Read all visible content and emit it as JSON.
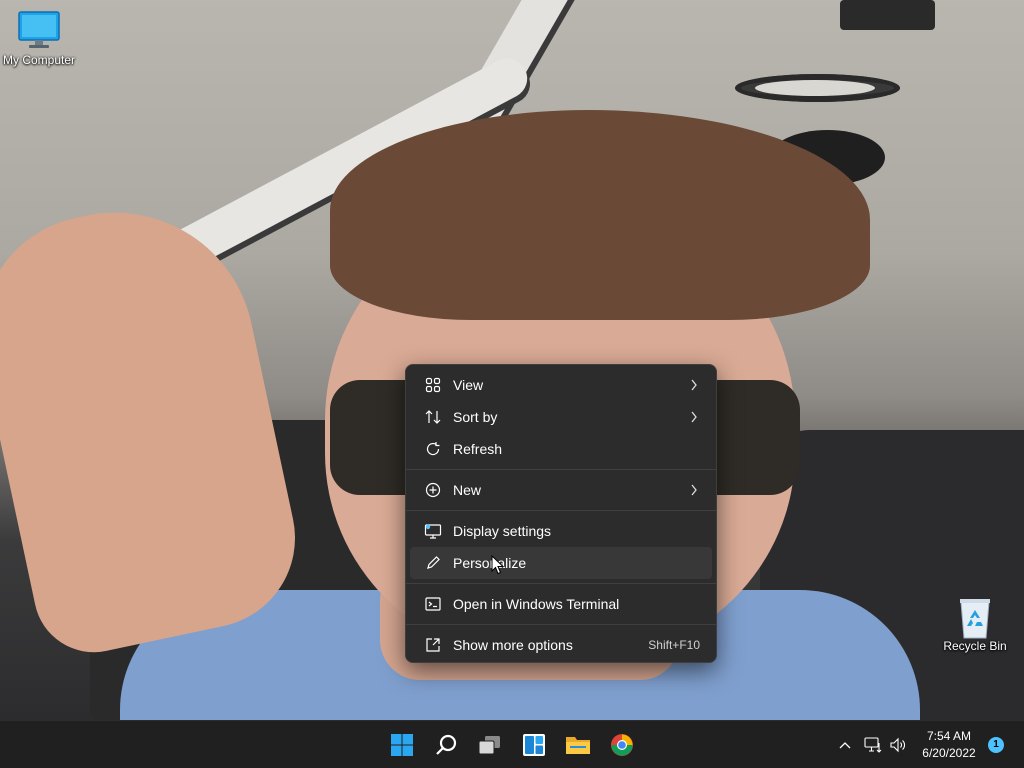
{
  "desktop": {
    "icons": [
      {
        "label": "My Computer"
      },
      {
        "label": "Recycle Bin"
      }
    ]
  },
  "context_menu": {
    "items": [
      {
        "label": "View",
        "icon": "grid-icon",
        "has_submenu": true
      },
      {
        "label": "Sort by",
        "icon": "sort-icon",
        "has_submenu": true
      },
      {
        "label": "Refresh",
        "icon": "refresh-icon",
        "has_submenu": false
      },
      {
        "label": "New",
        "icon": "plus-circle-icon",
        "has_submenu": true
      },
      {
        "label": "Display settings",
        "icon": "display-icon",
        "has_submenu": false
      },
      {
        "label": "Personalize",
        "icon": "pen-icon",
        "has_submenu": false,
        "hovered": true
      },
      {
        "label": "Open in Windows Terminal",
        "icon": "terminal-icon",
        "has_submenu": false
      },
      {
        "label": "Show more options",
        "icon": "external-icon",
        "shortcut": "Shift+F10"
      }
    ]
  },
  "taskbar": {
    "apps": [
      "start-icon",
      "search-icon",
      "task-view-icon",
      "widgets-icon",
      "file-explorer-icon",
      "chrome-icon"
    ],
    "clock": {
      "time": "7:54 AM",
      "date": "6/20/2022"
    },
    "notification_count": "1"
  },
  "colors": {
    "menu_bg": "#2c2c2c",
    "menu_hover": "#383838",
    "taskbar_bg": "#202020",
    "accent": "#4cc2ff"
  }
}
